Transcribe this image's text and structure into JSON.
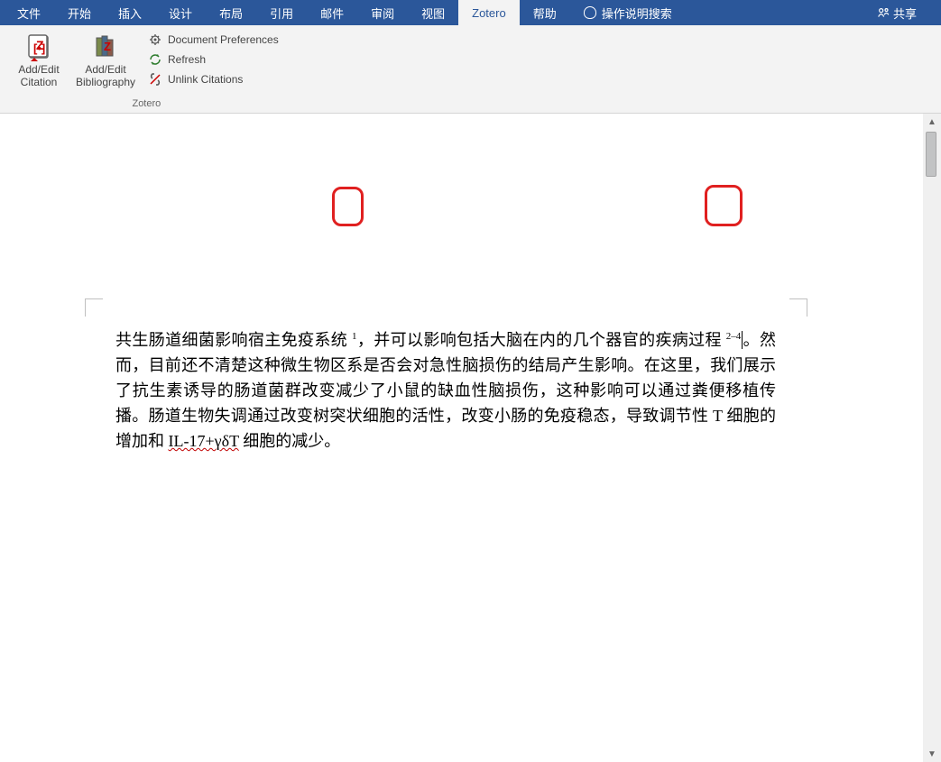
{
  "menu": {
    "items": [
      "文件",
      "开始",
      "插入",
      "设计",
      "布局",
      "引用",
      "邮件",
      "审阅",
      "视图",
      "Zotero",
      "帮助"
    ],
    "active_index": 9,
    "help_search": "操作说明搜索",
    "share": "共享"
  },
  "ribbon": {
    "group_label": "Zotero",
    "big_buttons": [
      {
        "line1": "Add/Edit",
        "line2": "Citation"
      },
      {
        "line1": "Add/Edit",
        "line2": "Bibliography"
      }
    ],
    "small_buttons": [
      {
        "label": "Document Preferences",
        "icon": "gear-icon"
      },
      {
        "label": "Refresh",
        "icon": "refresh-icon"
      },
      {
        "label": "Unlink Citations",
        "icon": "unlink-icon"
      }
    ]
  },
  "document": {
    "seg1": "共生肠道细菌影响宿主免疫系统 ",
    "ref1": "1",
    "seg2": "，并可以影响包括大脑在内的几个器官的疾病过程 ",
    "ref2": "2–4",
    "seg3": "。然而，目前还不清楚这种微生物区系是否会对急性脑损伤的结局产生影响。在这里，我们展示了抗生素诱导的肠道菌群改变减少了小鼠的缺血性脑损伤，这种影响可以通过粪便移植传播。肠道生物失调通过改变树突状细胞的活性，改变小肠的免疫稳态，导致调节性 T 细胞的增加和 ",
    "squiggle_text": "IL-17+γδT",
    "seg4": " 细胞的减少。"
  },
  "colors": {
    "word_blue": "#2b579a",
    "ribbon_bg": "#f3f3f3",
    "highlight_red": "#e02020"
  }
}
